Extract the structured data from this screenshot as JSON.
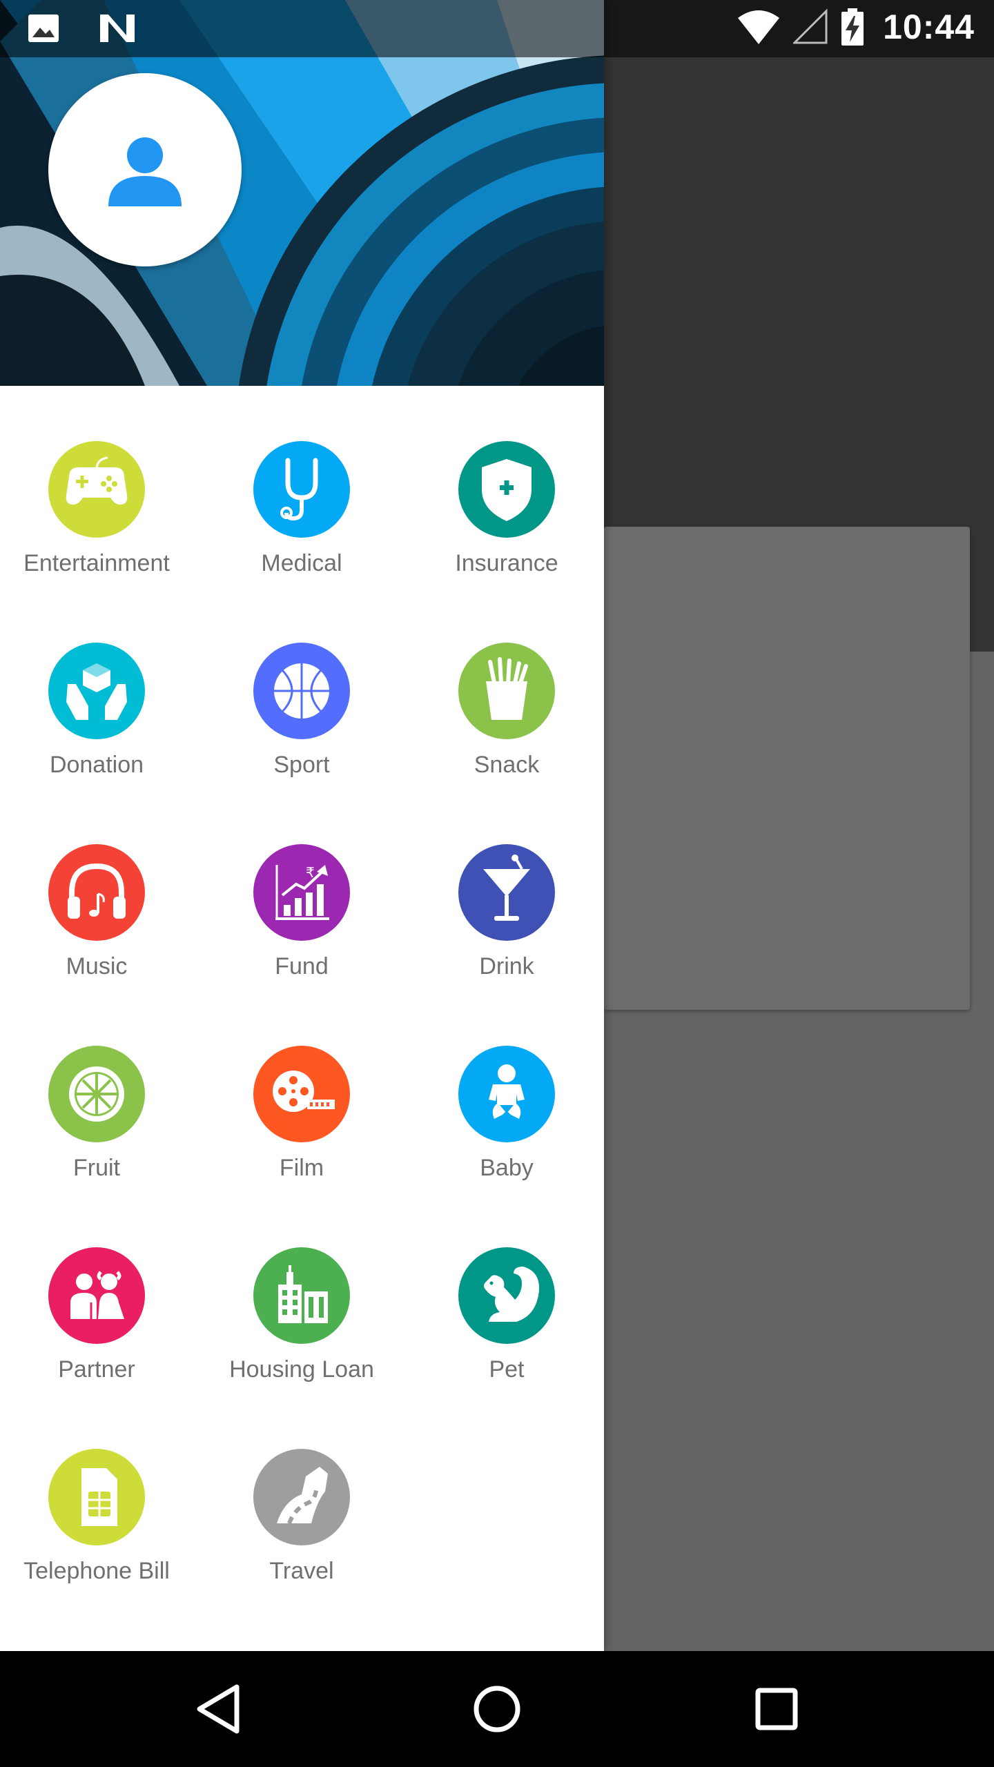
{
  "status_bar": {
    "time": "10:44",
    "left_icons": [
      "image-icon",
      "n-notification-icon"
    ],
    "right_icons": [
      "wifi-icon",
      "signal-icon",
      "battery-charging-icon"
    ]
  },
  "drawer": {
    "avatar_icon": "person-icon",
    "avatar_color": "#2196F3",
    "categories": [
      {
        "label": "Entertainment",
        "icon": "gamepad-icon",
        "color": "#CDDC39"
      },
      {
        "label": "Medical",
        "icon": "stethoscope-icon",
        "color": "#03A9F4"
      },
      {
        "label": "Insurance",
        "icon": "shield-plus-icon",
        "color": "#009688"
      },
      {
        "label": "Donation",
        "icon": "hands-box-icon",
        "color": "#00BCD4"
      },
      {
        "label": "Sport",
        "icon": "basketball-icon",
        "color": "#536DFE"
      },
      {
        "label": "Snack",
        "icon": "fries-icon",
        "color": "#8BC34A"
      },
      {
        "label": "Music",
        "icon": "headphones-icon",
        "color": "#F44336"
      },
      {
        "label": "Fund",
        "icon": "chart-rupee-icon",
        "color": "#9C27B0"
      },
      {
        "label": "Drink",
        "icon": "cocktail-icon",
        "color": "#3F51B5"
      },
      {
        "label": "Fruit",
        "icon": "citrus-icon",
        "color": "#8BC34A"
      },
      {
        "label": "Film",
        "icon": "film-reel-icon",
        "color": "#FF5722"
      },
      {
        "label": "Baby",
        "icon": "baby-icon",
        "color": "#03A9F4"
      },
      {
        "label": "Partner",
        "icon": "couple-icon",
        "color": "#E91E63"
      },
      {
        "label": "Housing Loan",
        "icon": "buildings-icon",
        "color": "#4CAF50"
      },
      {
        "label": "Pet",
        "icon": "squirrel-icon",
        "color": "#009688"
      },
      {
        "label": "Telephone Bill",
        "icon": "sim-card-icon",
        "color": "#CDDC39"
      },
      {
        "label": "Travel",
        "icon": "road-icon",
        "color": "#9E9E9E"
      }
    ]
  },
  "nav_bar": {
    "back_icon": "back-triangle-icon",
    "home_icon": "home-circle-icon",
    "recents_icon": "recents-square-icon"
  }
}
